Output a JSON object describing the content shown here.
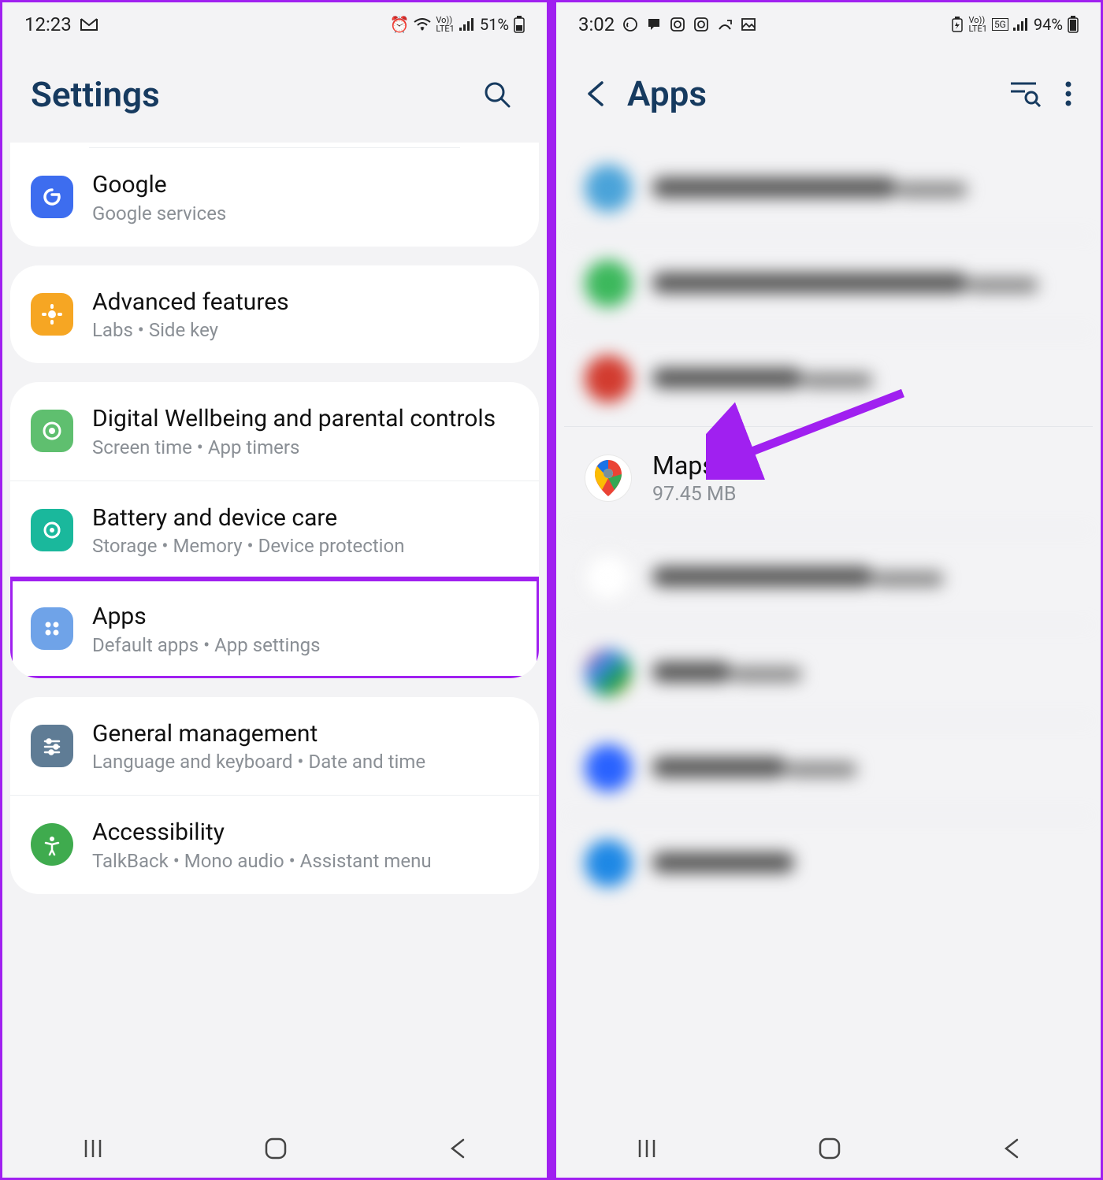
{
  "left": {
    "status": {
      "time": "12:23",
      "battery": "51%"
    },
    "header": {
      "title": "Settings"
    },
    "google": {
      "title": "Google",
      "sub": "Google services"
    },
    "advanced": {
      "title": "Advanced features",
      "sub": "Labs  •  Side key"
    },
    "wellbeing": {
      "title": "Digital Wellbeing and parental controls",
      "sub": "Screen time  •  App timers"
    },
    "battery": {
      "title": "Battery and device care",
      "sub": "Storage  •  Memory  •  Device protection"
    },
    "apps": {
      "title": "Apps",
      "sub": "Default apps  •  App settings"
    },
    "general": {
      "title": "General management",
      "sub": "Language and keyboard  •  Date and time"
    },
    "accessibility": {
      "title": "Accessibility",
      "sub": "TalkBack  •  Mono audio  •  Assistant menu"
    }
  },
  "right": {
    "status": {
      "time": "3:02",
      "battery": "94%"
    },
    "header": {
      "title": "Apps"
    },
    "maps": {
      "title": "Maps",
      "sub": "97.45 MB"
    }
  }
}
